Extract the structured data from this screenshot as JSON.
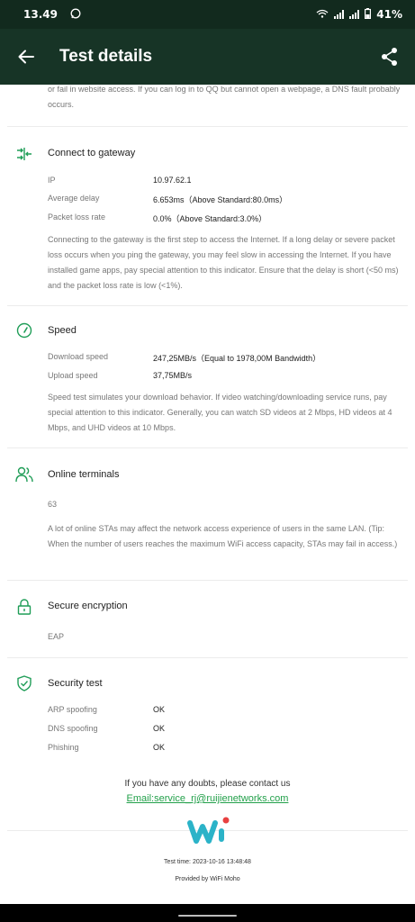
{
  "status_bar": {
    "time": "13.49",
    "battery": "41%"
  },
  "app_bar": {
    "title": "Test details"
  },
  "intro": {
    "text": "or fail in website access. If you can log in to QQ but cannot open a webpage, a DNS fault probably occurs."
  },
  "gateway": {
    "title": "Connect to gateway",
    "rows": [
      {
        "key": "IP",
        "value": "10.97.62.1"
      },
      {
        "key": "Average delay",
        "value": "6.653ms（Above Standard:80.0ms）"
      },
      {
        "key": "Packet loss rate",
        "value": "0.0%（Above Standard:3.0%）"
      }
    ],
    "description": "Connecting to the gateway is the first step to access the Internet. If a long delay or severe packet loss occurs when you ping the gateway, you may feel slow in accessing the Internet. If you have installed game apps, pay special attention to this indicator. Ensure that the delay is short (<50 ms) and the packet loss rate is low (<1%)."
  },
  "speed": {
    "title": "Speed",
    "rows": [
      {
        "key": "Download speed",
        "value": "247,25MB/s（Equal to 1978,00M Bandwidth）"
      },
      {
        "key": "Upload speed",
        "value": "37,75MB/s"
      }
    ],
    "description": "Speed test simulates your download behavior. If video watching/downloading service runs, pay special attention to this indicator. Generally, you can watch SD videos at 2 Mbps, HD videos at 4 Mbps, and UHD videos at 10 Mbps."
  },
  "terminals": {
    "title": "Online terminals",
    "value": "63",
    "description": "A lot of online STAs may affect the network access experience of users in the same LAN. (Tip: When the number of users reaches the maximum WiFi access capacity, STAs may fail in access.)"
  },
  "encryption": {
    "title": "Secure encryption",
    "value": "EAP"
  },
  "security": {
    "title": "Security test",
    "rows": [
      {
        "key": "ARP spoofing",
        "value": "OK"
      },
      {
        "key": "DNS spoofing",
        "value": "OK"
      },
      {
        "key": "Phishing",
        "value": "OK"
      }
    ]
  },
  "footer": {
    "contact": "If you have any doubts, please contact us",
    "email": "Email:service_rj@ruijienetworks.com",
    "test_time": "Test time: 2023-10-16 13:48:48",
    "provided_by": "Provided by WiFi Moho"
  },
  "colors": {
    "app_bar": "#173426",
    "status_bar": "#122a1e",
    "accent": "#1f9d57",
    "link": "#22a04a"
  },
  "icons": [
    "back-arrow-icon",
    "share-icon",
    "gateway-icon",
    "speed-gauge-icon",
    "users-icon",
    "lock-icon",
    "shield-check-icon",
    "whatsapp-icon",
    "wifi-icon",
    "signal-icon",
    "battery-icon"
  ]
}
